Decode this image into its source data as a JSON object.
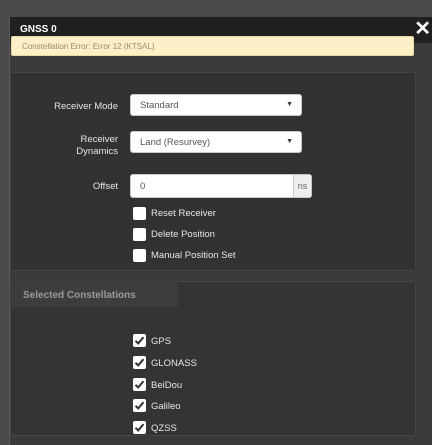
{
  "dialog": {
    "title": "GNSS 0",
    "close_glyph": "✕"
  },
  "alert": {
    "text": "Constellation Error: Error 12 (KTSAL)"
  },
  "receiver": {
    "mode_label": "Receiver Mode",
    "mode_value": "Standard",
    "dynamics_label_line1": "Receiver",
    "dynamics_label_line2": "Dynamics",
    "dynamics_value": "Land (Resurvey)",
    "offset_label": "Offset",
    "offset_value": "0",
    "offset_unit": "ns",
    "options": [
      {
        "label": "Reset Receiver",
        "checked": false
      },
      {
        "label": "Delete Position",
        "checked": false
      },
      {
        "label": "Manual Position Set",
        "checked": false
      }
    ]
  },
  "constellations": {
    "legend": "Selected Constellations",
    "items": [
      {
        "label": "GPS",
        "checked": true
      },
      {
        "label": "GLONASS",
        "checked": true
      },
      {
        "label": "BeiDou",
        "checked": true
      },
      {
        "label": "Galileo",
        "checked": true
      },
      {
        "label": "QZSS",
        "checked": true
      }
    ]
  },
  "colors": {
    "alert_bg": "#fbf0c8",
    "alert_text": "#9a8b6a",
    "titlebar_bg": "#202020",
    "dialog_bg": "#3a3a3a"
  },
  "icons": {
    "close": "close-icon",
    "select_caret": "caret-down-icon",
    "checkmark": "checkmark-icon"
  }
}
